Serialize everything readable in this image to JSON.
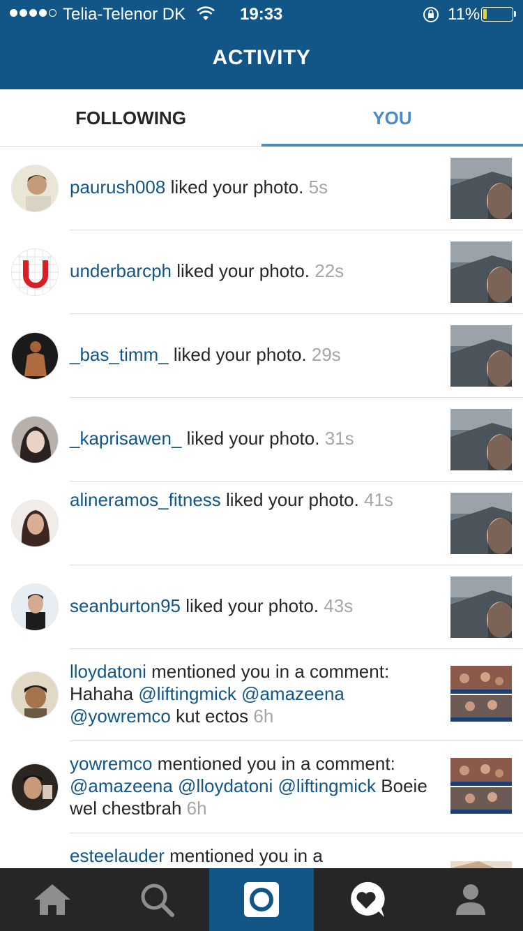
{
  "status_bar": {
    "carrier": "Telia-Telenor DK",
    "time": "19:33",
    "battery": "11%",
    "signal_bars": 4
  },
  "header": {
    "title": "ACTIVITY"
  },
  "tabs": [
    {
      "label": "FOLLOWING",
      "active": false
    },
    {
      "label": "YOU",
      "active": true
    }
  ],
  "activity": [
    {
      "username": "paurush008",
      "action": "liked your photo.",
      "ago": "5s"
    },
    {
      "username": "underbarcph",
      "action": "liked your photo.",
      "ago": "22s"
    },
    {
      "username": "_bas_timm_",
      "action": "liked your photo.",
      "ago": "29s"
    },
    {
      "username": "_kaprisawen_",
      "action": "liked your photo.",
      "ago": "31s"
    },
    {
      "username": "alineramos_fitness",
      "action": "liked your photo.",
      "ago": "41s"
    },
    {
      "username": "seanburton95",
      "action": "liked your photo.",
      "ago": "43s"
    },
    {
      "username": "lloydatoni",
      "action": "mentioned you in a comment:",
      "comment_pre": "Hahaha",
      "mentions": [
        "@liftingmick",
        "@amazeena",
        "@yowremco"
      ],
      "comment_post": "kut ectos",
      "ago": "6h"
    },
    {
      "username": "yowremco",
      "action": "mentioned you in a comment:",
      "mentions": [
        "@amazeena",
        "@lloydatoni",
        "@liftingmick"
      ],
      "comment_post": "Boeie wel chestbrah",
      "ago": "6h"
    },
    {
      "username": "esteelauder",
      "action": "mentioned you in a"
    }
  ],
  "bottom_nav": [
    {
      "icon": "home-icon",
      "active": false
    },
    {
      "icon": "search-icon",
      "active": false
    },
    {
      "icon": "camera-icon",
      "active": true
    },
    {
      "icon": "activity-heart-icon",
      "active": false
    },
    {
      "icon": "profile-icon",
      "active": false
    }
  ],
  "colors": {
    "brand_blue": "#125688",
    "tab_active": "#4a8cc4",
    "nav_bg": "#262626",
    "timestamp_gray": "#a6a6a6"
  }
}
